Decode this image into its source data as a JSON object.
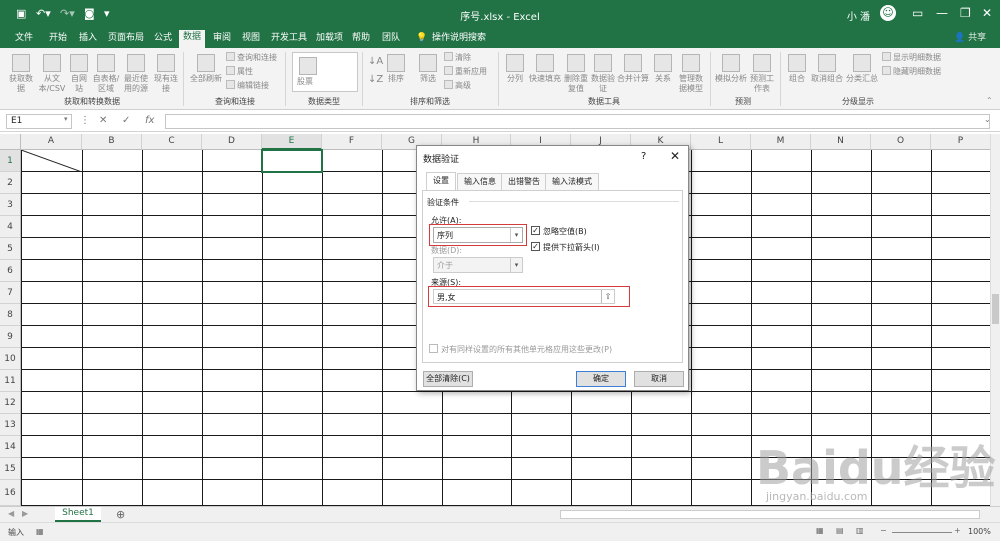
{
  "app": {
    "title": "序号.xlsx - Excel",
    "user": "小 潘",
    "share": "共享"
  },
  "tabs": [
    "文件",
    "开始",
    "插入",
    "页面布局",
    "公式",
    "数据",
    "审阅",
    "视图",
    "开发工具",
    "加载项",
    "帮助",
    "团队"
  ],
  "active_tab": "数据",
  "tell_me": "操作说明搜索",
  "ribbon": {
    "groups": [
      "获取和转换数据",
      "查询和连接",
      "数据类型",
      "排序和筛选",
      "数据工具",
      "预测",
      "分级显示"
    ],
    "get_data": [
      "获取数据",
      "从文本/CSV",
      "自网站",
      "自表格/区域",
      "最近使用的源",
      "现有连接"
    ],
    "queries": {
      "refresh": "全部刷新",
      "queries_connections": "查询和连接",
      "properties": "属性",
      "edit_links": "编辑链接"
    },
    "data_types": {
      "stocks": "股票"
    },
    "sort_filter": {
      "sort": "排序",
      "filter": "筛选",
      "clear": "清除",
      "reapply": "重新应用",
      "advanced": "高级"
    },
    "data_tools": [
      "分列",
      "快速填充",
      "删除重复值",
      "数据验证",
      "合并计算",
      "关系",
      "管理数据模型"
    ],
    "forecast": [
      "模拟分析",
      "预测工作表"
    ],
    "outline": {
      "group": "组合",
      "ungroup": "取消组合",
      "subtotal": "分类汇总",
      "show_detail": "显示明细数据",
      "hide_detail": "隐藏明细数据"
    }
  },
  "formula_bar": {
    "name_box": "E1",
    "cancel": "✕",
    "enter": "✓",
    "fx": "fx",
    "value": ""
  },
  "columns": [
    "A",
    "B",
    "C",
    "D",
    "E",
    "F",
    "G",
    "H",
    "I",
    "J",
    "K",
    "L",
    "M",
    "N",
    "O",
    "P"
  ],
  "rows": [
    "1",
    "2",
    "3",
    "4",
    "5",
    "6",
    "7",
    "8",
    "9",
    "10",
    "11",
    "12",
    "13",
    "14",
    "15",
    "16"
  ],
  "selected_cell": "E1",
  "sheet_tabs": [
    "Sheet1"
  ],
  "status": {
    "mode": "输入",
    "zoom": "100%"
  },
  "dialog": {
    "title": "数据验证",
    "help": "?",
    "close": "✕",
    "tabs": [
      "设置",
      "输入信息",
      "出错警告",
      "输入法模式"
    ],
    "section": "验证条件",
    "allow_label": "允许(A):",
    "allow_value": "序列",
    "ignore_blank": "忽略空值(B)",
    "in_cell_dropdown": "提供下拉箭头(I)",
    "data_label": "数据(D):",
    "data_value": "介于",
    "source_label": "来源(S):",
    "source_value": "男,女",
    "apply_all": "对有同样设置的所有其他单元格应用这些更改(P)",
    "clear_all": "全部清除(C)",
    "ok": "确定",
    "cancel": "取消"
  },
  "watermark": {
    "brand": "Baidu经验",
    "url": "jingyan.baidu.com"
  }
}
